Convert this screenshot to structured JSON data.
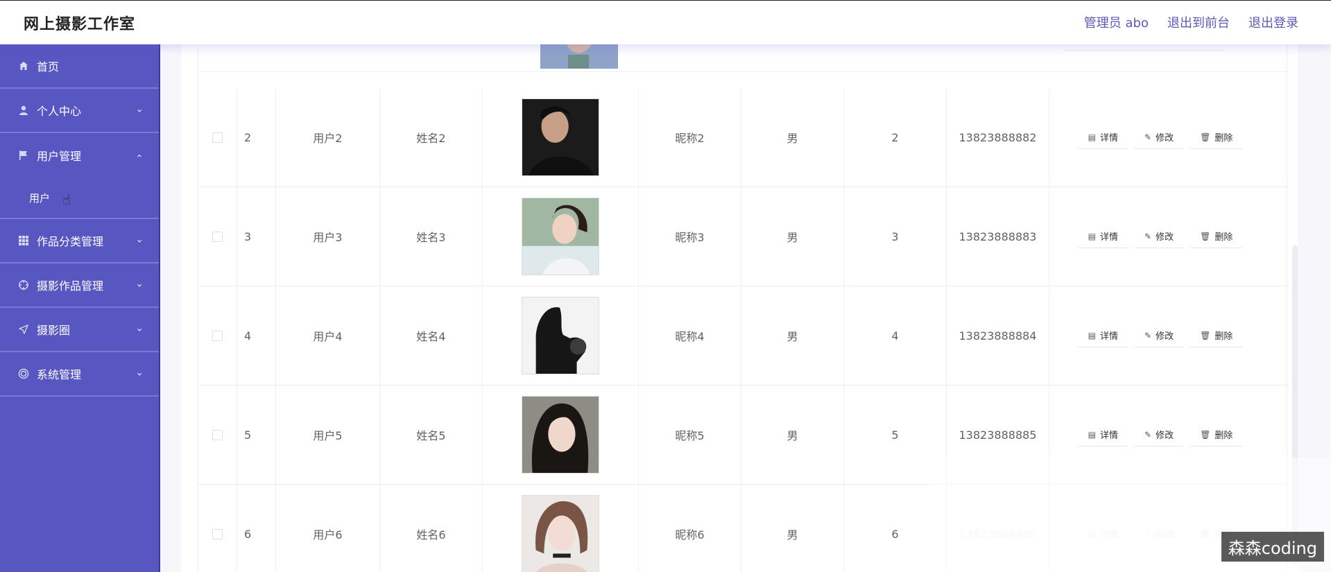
{
  "header": {
    "brand": "网上摄影工作室",
    "admin_label": "管理员 abo",
    "to_front_label": "退出到前台",
    "logout_label": "退出登录"
  },
  "sidebar": {
    "items": [
      {
        "label": "首页",
        "icon": "home-icon",
        "expandable": false
      },
      {
        "label": "个人中心",
        "icon": "user-icon",
        "expandable": true,
        "expanded": false
      },
      {
        "label": "用户管理",
        "icon": "flag-icon",
        "expandable": true,
        "expanded": true,
        "children": [
          "用户"
        ]
      },
      {
        "label": "作品分类管理",
        "icon": "grid-icon",
        "expandable": true,
        "expanded": false
      },
      {
        "label": "摄影作品管理",
        "icon": "crosshair-icon",
        "expandable": true,
        "expanded": false
      },
      {
        "label": "摄影圈",
        "icon": "send-icon",
        "expandable": true,
        "expanded": false
      },
      {
        "label": "系统管理",
        "icon": "target-icon",
        "expandable": true,
        "expanded": false
      }
    ]
  },
  "table": {
    "ops": {
      "detail": "详情",
      "edit": "修改",
      "delete": "删除"
    },
    "rows": [
      {
        "index": "2",
        "account": "用户2",
        "name": "姓名2",
        "nickname": "昵称2",
        "gender": "男",
        "age": "2",
        "phone": "13823888882"
      },
      {
        "index": "3",
        "account": "用户3",
        "name": "姓名3",
        "nickname": "昵称3",
        "gender": "男",
        "age": "3",
        "phone": "13823888883"
      },
      {
        "index": "4",
        "account": "用户4",
        "name": "姓名4",
        "nickname": "昵称4",
        "gender": "男",
        "age": "4",
        "phone": "13823888884"
      },
      {
        "index": "5",
        "account": "用户5",
        "name": "姓名5",
        "nickname": "昵称5",
        "gender": "男",
        "age": "5",
        "phone": "13823888885"
      },
      {
        "index": "6",
        "account": "用户6",
        "name": "姓名6",
        "nickname": "昵称6",
        "gender": "男",
        "age": "6",
        "phone": "13823888886"
      }
    ]
  },
  "watermark": "森森coding"
}
